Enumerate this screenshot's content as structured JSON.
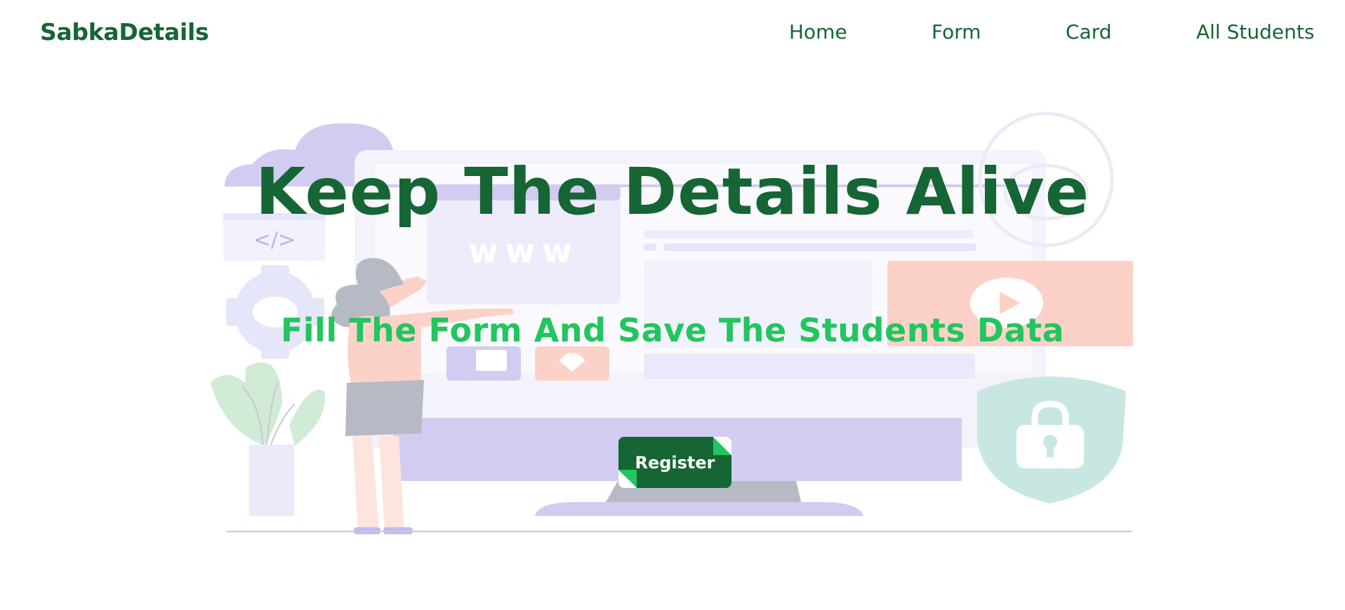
{
  "navbar": {
    "brand": "SabkaDetails",
    "links": [
      "Home",
      "Form",
      "Card",
      "All Students"
    ]
  },
  "hero": {
    "title": "Keep The Details Alive",
    "subtitle": "Fill The Form And Save The Students Data",
    "register_label": "Register",
    "illustration_code_tag": "</>",
    "illustration_url_text": "www"
  },
  "colors": {
    "brand_green": "#166534",
    "accent_green": "#22c55e",
    "background": "#ffffff"
  },
  "icons": [
    "gear-icon",
    "play-icon",
    "lock-icon",
    "shield-icon",
    "heart-icon",
    "cloud-icon"
  ]
}
